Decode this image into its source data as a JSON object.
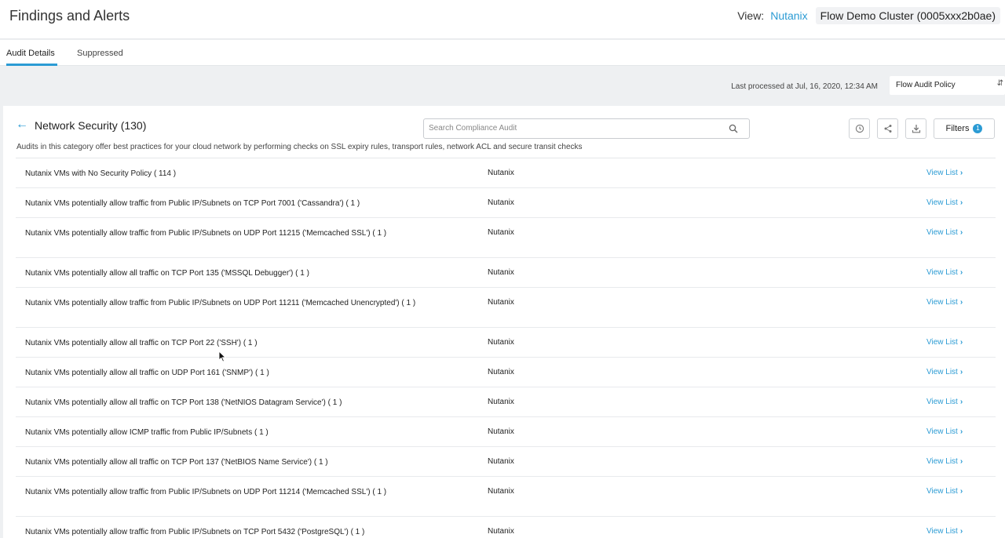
{
  "header": {
    "title": "Findings and Alerts",
    "view_label": "View:",
    "view_link": "Nutanix",
    "cluster": "Flow Demo Cluster (0005xxx2b0ae)"
  },
  "tabs": [
    {
      "label": "Audit Details",
      "active": true
    },
    {
      "label": "Suppressed",
      "active": false
    }
  ],
  "process": {
    "last_processed": "Last processed at Jul, 16, 2020, 12:34 AM",
    "policy": "Flow Audit Policy"
  },
  "section": {
    "title": "Network Security (130)",
    "description": "Audits in this category offer best practices for your cloud network by performing checks on SSL expiry rules, transport rules, network ACL and secure transit checks"
  },
  "search": {
    "placeholder": "Search Compliance Audit"
  },
  "toolbar": {
    "filters_label": "Filters",
    "filters_count": "1"
  },
  "colors": {
    "accent": "#2b9bd4"
  },
  "icons": [
    "back-arrow-icon",
    "search-icon",
    "history-icon",
    "share-icon",
    "download-icon",
    "chevron-right-icon"
  ],
  "rows": [
    {
      "name": "Nutanix VMs with No Security Policy ( 114 )",
      "provider": "Nutanix",
      "link": "View List"
    },
    {
      "name": "Nutanix VMs potentially allow traffic from Public IP/Subnets on TCP Port 7001 ('Cassandra') ( 1 )",
      "provider": "Nutanix",
      "link": "View List"
    },
    {
      "name": "Nutanix VMs potentially allow traffic from Public IP/Subnets on UDP Port 11215 ('Memcached SSL') ( 1 )",
      "provider": "Nutanix",
      "link": "View List"
    },
    {
      "name": "Nutanix VMs potentially allow all traffic on TCP Port 135 ('MSSQL Debugger') ( 1 )",
      "provider": "Nutanix",
      "link": "View List"
    },
    {
      "name": "Nutanix VMs potentially allow traffic from Public IP/Subnets on UDP Port 11211 ('Memcached Unencrypted') ( 1 )",
      "provider": "Nutanix",
      "link": "View List"
    },
    {
      "name": "Nutanix VMs potentially allow all traffic on TCP Port 22 ('SSH') ( 1 )",
      "provider": "Nutanix",
      "link": "View List"
    },
    {
      "name": "Nutanix VMs potentially allow all traffic on UDP Port 161 ('SNMP') ( 1 )",
      "provider": "Nutanix",
      "link": "View List"
    },
    {
      "name": "Nutanix VMs potentially allow all traffic on TCP Port 138 ('NetNIOS Datagram Service') ( 1 )",
      "provider": "Nutanix",
      "link": "View List"
    },
    {
      "name": "Nutanix VMs potentially allow ICMP traffic from Public IP/Subnets ( 1 )",
      "provider": "Nutanix",
      "link": "View List"
    },
    {
      "name": "Nutanix VMs potentially allow all traffic on TCP Port 137 ('NetBIOS Name Service') ( 1 )",
      "provider": "Nutanix",
      "link": "View List"
    },
    {
      "name": "Nutanix VMs potentially allow traffic from Public IP/Subnets on UDP Port 11214 ('Memcached SSL') ( 1 )",
      "provider": "Nutanix",
      "link": "View List"
    },
    {
      "name": "Nutanix VMs potentially allow traffic from Public IP/Subnets on TCP Port 5432 ('PostgreSQL') ( 1 )",
      "provider": "Nutanix",
      "link": "View List"
    }
  ]
}
